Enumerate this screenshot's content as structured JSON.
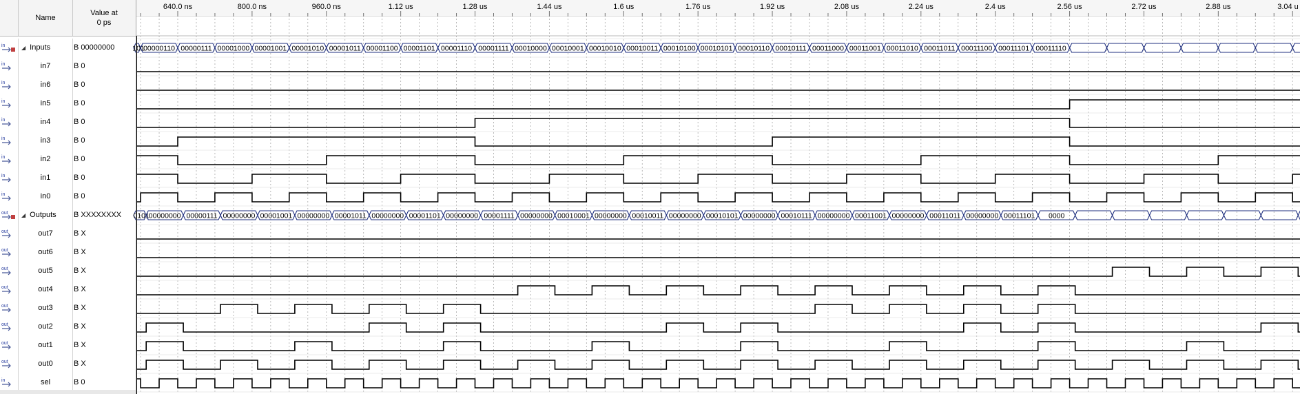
{
  "header": {
    "name_label": "Name",
    "value_label_line1": "Value at",
    "value_label_line2": "0 ps"
  },
  "rows": [
    {
      "name": "Inputs",
      "value": "B 00000000",
      "icon": "input-bus-icon",
      "group": true
    },
    {
      "name": "in7",
      "value": "B 0",
      "icon": "input-pin-icon"
    },
    {
      "name": "in6",
      "value": "B 0",
      "icon": "input-pin-icon"
    },
    {
      "name": "in5",
      "value": "B 0",
      "icon": "input-pin-icon"
    },
    {
      "name": "in4",
      "value": "B 0",
      "icon": "input-pin-icon"
    },
    {
      "name": "in3",
      "value": "B 0",
      "icon": "input-pin-icon"
    },
    {
      "name": "in2",
      "value": "B 0",
      "icon": "input-pin-icon"
    },
    {
      "name": "in1",
      "value": "B 0",
      "icon": "input-pin-icon"
    },
    {
      "name": "in0",
      "value": "B 0",
      "icon": "input-pin-icon"
    },
    {
      "name": "Outputs",
      "value": "B XXXXXXXX",
      "icon": "output-bus-icon",
      "group": true
    },
    {
      "name": "out7",
      "value": "B X",
      "icon": "output-pin-icon"
    },
    {
      "name": "out6",
      "value": "B X",
      "icon": "output-pin-icon"
    },
    {
      "name": "out5",
      "value": "B X",
      "icon": "output-pin-icon"
    },
    {
      "name": "out4",
      "value": "B X",
      "icon": "output-pin-icon"
    },
    {
      "name": "out3",
      "value": "B X",
      "icon": "output-pin-icon"
    },
    {
      "name": "out2",
      "value": "B X",
      "icon": "output-pin-icon"
    },
    {
      "name": "out1",
      "value": "B X",
      "icon": "output-pin-icon"
    },
    {
      "name": "out0",
      "value": "B X",
      "icon": "output-pin-icon"
    },
    {
      "name": "sel",
      "value": "B 0",
      "icon": "input-pin-icon"
    }
  ],
  "time_axis": {
    "labels": [
      "640.0 ns",
      "800.0 ns",
      "960.0 ns",
      "1.12 us",
      "1.28 us",
      "1.44 us",
      "1.6 us",
      "1.76 us",
      "1.92 us",
      "2.08 us",
      "2.24 us",
      "2.4 us",
      "2.56 us",
      "2.72 us",
      "2.88 us",
      "3.04 u"
    ],
    "label_times_ns": [
      640,
      800,
      960,
      1120,
      1280,
      1440,
      1600,
      1760,
      1920,
      2080,
      2240,
      2400,
      2560,
      2720,
      2880,
      3040
    ],
    "view_start_ns": 551,
    "view_end_ns": 3056
  },
  "waves": {
    "inputs_bus_values": [
      "101",
      "00000110",
      "00000111",
      "00001000",
      "00001001",
      "00001010",
      "00001011",
      "00001100",
      "00001101",
      "00001110",
      "00001111",
      "00010000",
      "00010001",
      "00010010",
      "00010011",
      "00010100",
      "00010101",
      "00010110",
      "00010111",
      "00011000",
      "00011001",
      "00011010",
      "00011011",
      "00011100",
      "00011101",
      "00011110"
    ],
    "outputs_bus_values": [
      "0101",
      "00000000",
      "00000111",
      "00000000",
      "00001001",
      "00000000",
      "00001011",
      "00000000",
      "00001101",
      "00000000",
      "00001111",
      "00000000",
      "00010001",
      "00000000",
      "00010011",
      "00000000",
      "00010101",
      "00000000",
      "00010111",
      "00000000",
      "00011001",
      "00000000",
      "00011011",
      "00000000",
      "00011101",
      "0000"
    ],
    "input_bit_names": [
      "in7",
      "in6",
      "in5",
      "in4",
      "in3",
      "in2",
      "in1",
      "in0"
    ],
    "output_bit_names": [
      "out7",
      "out6",
      "out5",
      "out4",
      "out3",
      "out2",
      "out1",
      "out0"
    ],
    "colors": {
      "signal": "#000000",
      "bus": "#1f2f7f",
      "grid": "#a8a8a8",
      "background": "#ffffff"
    }
  }
}
